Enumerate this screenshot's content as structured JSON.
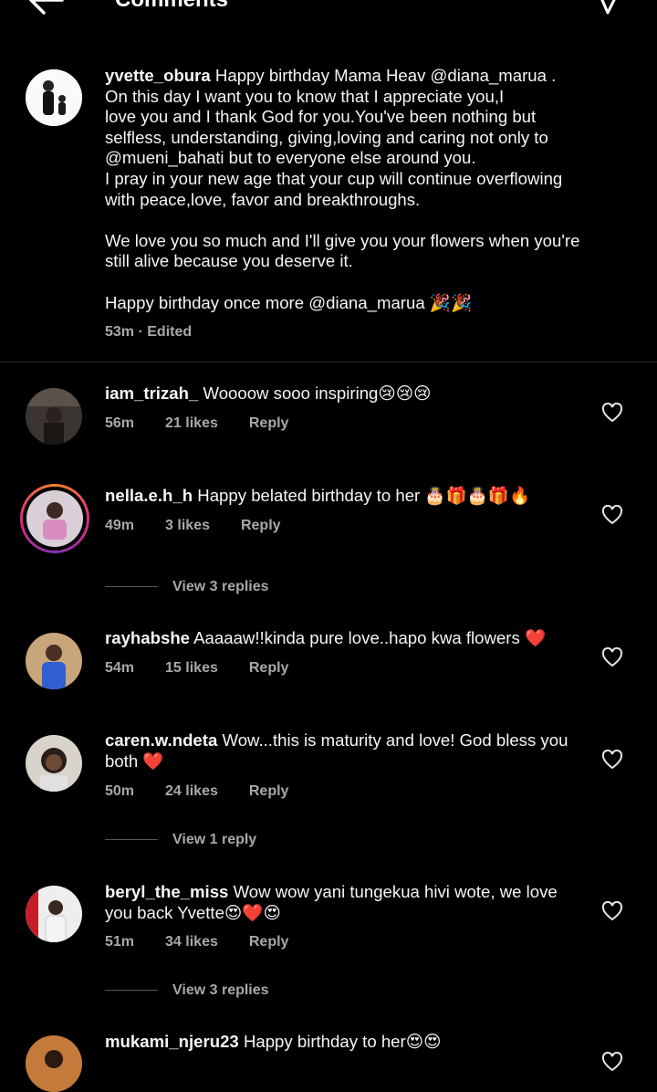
{
  "header": {
    "title": "Comments"
  },
  "caption": {
    "username": "yvette_obura",
    "line1": "Happy birthday Mama Heav @diana_marua .",
    "line2": "On this day I want you to know that I appreciate you,I",
    "line3": "love you and I thank God for you.You've been nothing but",
    "line4": "selfless, understanding, giving,loving and caring not only to",
    "line5": "@mueni_bahati but to everyone else around you.",
    "line6": "I pray in your new age that your cup will continue overflowing",
    "line7": "with peace,love, favor and breakthroughs.",
    "line8": "We love you so much and I'll give you your flowers when you're",
    "line9": "still alive because you deserve it.",
    "line10": "Happy birthday once more @diana_marua 🎉🎉",
    "time": "53m · Edited"
  },
  "comments": [
    {
      "username": "iam_trizah_",
      "text": "Woooow sooo inspiring😢😢😢",
      "time": "56m",
      "likes": "21 likes",
      "reply": "Reply"
    },
    {
      "username": "nella.e.h_h",
      "text": "Happy belated birthday to her 🎂🎁🎂🎁🔥",
      "time": "49m",
      "likes": "3 likes",
      "reply": "Reply",
      "view_replies": "View 3 replies"
    },
    {
      "username": "rayhabshe",
      "text": "Aaaaaw!!kinda pure love..hapo kwa flowers ❤️",
      "time": "54m",
      "likes": "15 likes",
      "reply": "Reply"
    },
    {
      "username": "caren.w.ndeta",
      "text": "Wow...this is maturity and love! God bless you",
      "text2": "both ❤️",
      "time": "50m",
      "likes": "24 likes",
      "reply": "Reply",
      "view_replies": "View 1 reply"
    },
    {
      "username": "beryl_the_miss",
      "text": "Wow wow yani tungekua hivi wote, we love",
      "text2": "you back Yvette😍❤️😍",
      "time": "51m",
      "likes": "34 likes",
      "reply": "Reply",
      "view_replies": "View 3 replies"
    },
    {
      "username": "mukami_njeru23",
      "text": "Happy birthday to her😍😍"
    }
  ]
}
